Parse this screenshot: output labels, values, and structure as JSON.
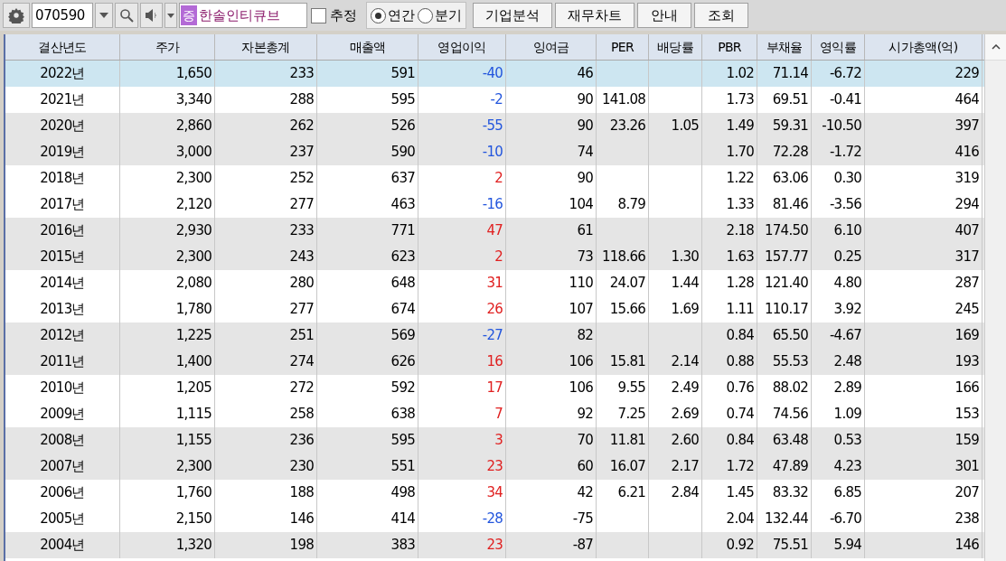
{
  "toolbar": {
    "code": "070590",
    "market_badge": "증",
    "company": "한솔인티큐브",
    "estimate": {
      "label": "추정",
      "checked": false
    },
    "period": [
      {
        "label": "연간",
        "selected": true
      },
      {
        "label": "분기",
        "selected": false
      }
    ],
    "buttons": [
      "기업분석",
      "재무차트",
      "안내",
      "조회"
    ]
  },
  "table": {
    "columns": [
      "결산년도",
      "주가",
      "자본총계",
      "매출액",
      "영업이익",
      "잉여금",
      "PER",
      "배당률",
      "PBR",
      "부채율",
      "영익률",
      "시가총액(억)"
    ],
    "rows": [
      {
        "selected": true,
        "color": "#2255dd",
        "cells": [
          "2022년",
          "1,650",
          "233",
          "591",
          "-40",
          "46",
          "",
          "",
          "1.02",
          "71.14",
          "-6.72",
          "229"
        ]
      },
      {
        "selected": false,
        "color": "#2255dd",
        "cells": [
          "2021년",
          "3,340",
          "288",
          "595",
          "-2",
          "90",
          "141.08",
          "",
          "1.73",
          "69.51",
          "-0.41",
          "464"
        ]
      },
      {
        "selected": false,
        "color": "#2255dd",
        "cells": [
          "2020년",
          "2,860",
          "262",
          "526",
          "-55",
          "90",
          "23.26",
          "1.05",
          "1.49",
          "59.31",
          "-10.50",
          "397"
        ]
      },
      {
        "selected": false,
        "color": "#2255dd",
        "cells": [
          "2019년",
          "3,000",
          "237",
          "590",
          "-10",
          "74",
          "",
          "",
          "1.70",
          "72.28",
          "-1.72",
          "416"
        ]
      },
      {
        "selected": false,
        "color": "#e02020",
        "cells": [
          "2018년",
          "2,300",
          "252",
          "637",
          "2",
          "90",
          "",
          "",
          "1.22",
          "63.06",
          "0.30",
          "319"
        ]
      },
      {
        "selected": false,
        "color": "#2255dd",
        "cells": [
          "2017년",
          "2,120",
          "277",
          "463",
          "-16",
          "104",
          "8.79",
          "",
          "1.33",
          "81.46",
          "-3.56",
          "294"
        ]
      },
      {
        "selected": false,
        "color": "#e02020",
        "cells": [
          "2016년",
          "2,930",
          "233",
          "771",
          "47",
          "61",
          "",
          "",
          "2.18",
          "174.50",
          "6.10",
          "407"
        ]
      },
      {
        "selected": false,
        "color": "#e02020",
        "cells": [
          "2015년",
          "2,300",
          "243",
          "623",
          "2",
          "73",
          "118.66",
          "1.30",
          "1.63",
          "157.77",
          "0.25",
          "317"
        ]
      },
      {
        "selected": false,
        "color": "#e02020",
        "cells": [
          "2014년",
          "2,080",
          "280",
          "648",
          "31",
          "110",
          "24.07",
          "1.44",
          "1.28",
          "121.40",
          "4.80",
          "287"
        ]
      },
      {
        "selected": false,
        "color": "#e02020",
        "cells": [
          "2013년",
          "1,780",
          "277",
          "674",
          "26",
          "107",
          "15.66",
          "1.69",
          "1.11",
          "110.17",
          "3.92",
          "245"
        ]
      },
      {
        "selected": false,
        "color": "#2255dd",
        "cells": [
          "2012년",
          "1,225",
          "251",
          "569",
          "-27",
          "82",
          "",
          "",
          "0.84",
          "65.50",
          "-4.67",
          "169"
        ]
      },
      {
        "selected": false,
        "color": "#e02020",
        "cells": [
          "2011년",
          "1,400",
          "274",
          "626",
          "16",
          "106",
          "15.81",
          "2.14",
          "0.88",
          "55.53",
          "2.48",
          "193"
        ]
      },
      {
        "selected": false,
        "color": "#e02020",
        "cells": [
          "2010년",
          "1,205",
          "272",
          "592",
          "17",
          "106",
          "9.55",
          "2.49",
          "0.76",
          "88.02",
          "2.89",
          "166"
        ]
      },
      {
        "selected": false,
        "color": "#e02020",
        "cells": [
          "2009년",
          "1,115",
          "258",
          "638",
          "7",
          "92",
          "7.25",
          "2.69",
          "0.74",
          "74.56",
          "1.09",
          "153"
        ]
      },
      {
        "selected": false,
        "color": "#e02020",
        "cells": [
          "2008년",
          "1,155",
          "236",
          "595",
          "3",
          "70",
          "11.81",
          "2.60",
          "0.84",
          "63.48",
          "0.53",
          "159"
        ]
      },
      {
        "selected": false,
        "color": "#e02020",
        "cells": [
          "2007년",
          "2,300",
          "230",
          "551",
          "23",
          "60",
          "16.07",
          "2.17",
          "1.72",
          "47.89",
          "4.23",
          "301"
        ]
      },
      {
        "selected": false,
        "color": "#e02020",
        "cells": [
          "2006년",
          "1,760",
          "188",
          "498",
          "34",
          "42",
          "6.21",
          "2.84",
          "1.45",
          "83.32",
          "6.85",
          "207"
        ]
      },
      {
        "selected": false,
        "color": "#2255dd",
        "cells": [
          "2005년",
          "2,150",
          "146",
          "414",
          "-28",
          "-75",
          "",
          "",
          "2.04",
          "132.44",
          "-6.70",
          "238"
        ]
      },
      {
        "selected": false,
        "color": "#e02020",
        "cells": [
          "2004년",
          "1,320",
          "198",
          "383",
          "23",
          "-87",
          "",
          "",
          "0.92",
          "75.51",
          "5.94",
          "146"
        ]
      }
    ]
  }
}
